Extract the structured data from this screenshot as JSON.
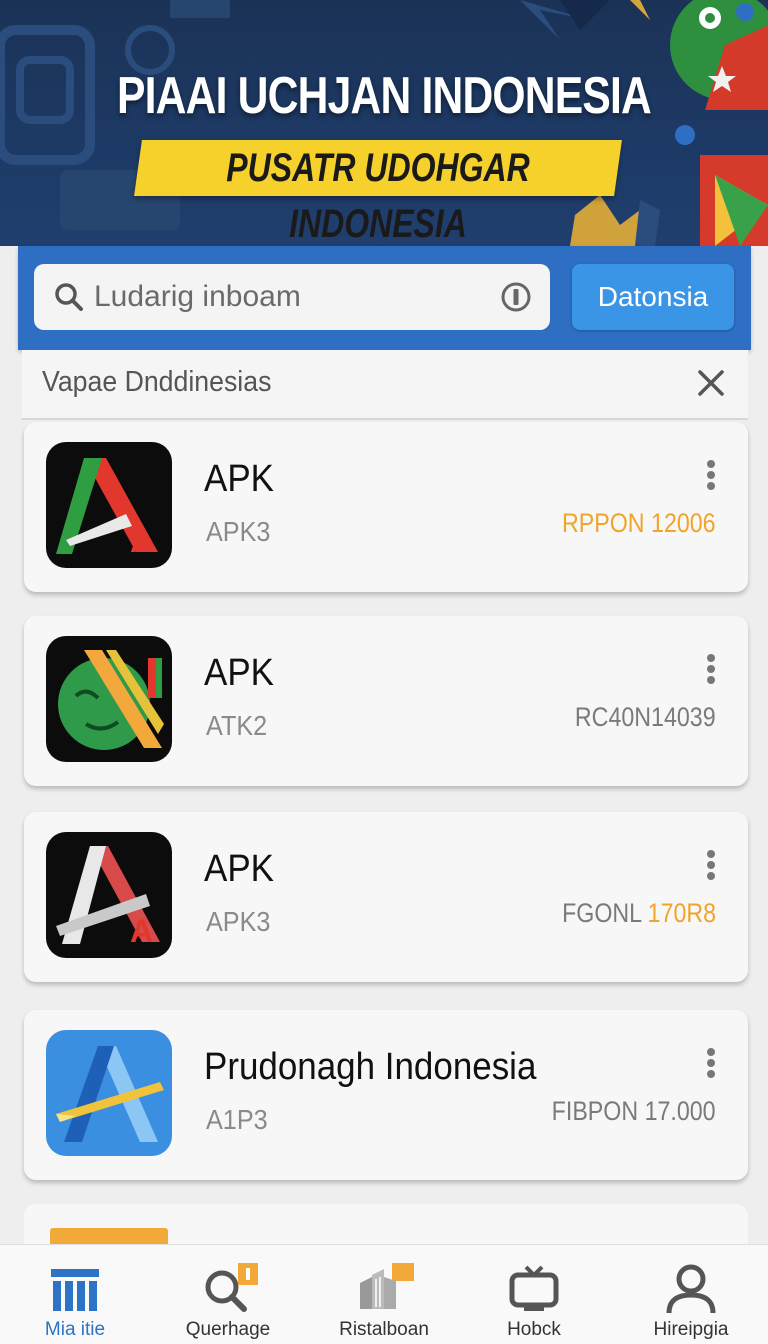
{
  "banner": {
    "title": "PIAAI UCHJAN INDONESIA",
    "subtitle": "PUSATR UDOHGAR INDONESIA"
  },
  "search": {
    "placeholder": "Ludarig inboam",
    "button_label": "Datonsia"
  },
  "filter": {
    "label": "Vapae Dnddinesias"
  },
  "apps": [
    {
      "name": "APK",
      "code": "APK3",
      "price": "RPPON 12006",
      "price_color": "#f0a42a",
      "icon": "red-green-a-icon"
    },
    {
      "name": "APK",
      "code": "ATK2",
      "price": "RC40N14039",
      "price_color": "#7a7a7a",
      "icon": "green-face-icon"
    },
    {
      "name": "APK",
      "code": "APK3",
      "price_prefix": "FGONL",
      "price": "170R8",
      "price_color": "#f0a42a",
      "icon": "white-red-a-icon"
    },
    {
      "name": "Prudonagh Indonesia",
      "code": "A1P3",
      "price": "FIBPON 17.000",
      "price_color": "#7a7a7a",
      "icon": "blue-a-icon"
    }
  ],
  "nav": {
    "items": [
      {
        "label": "Mia itie",
        "icon": "home-icon",
        "active": true
      },
      {
        "label": "Querhage",
        "icon": "search-icon",
        "active": false
      },
      {
        "label": "Ristalboan",
        "icon": "buildings-icon",
        "active": false
      },
      {
        "label": "Hobck",
        "icon": "tv-icon",
        "active": false
      },
      {
        "label": "Hireipgia",
        "icon": "profile-icon",
        "active": false
      }
    ]
  },
  "colors": {
    "banner_bg": "#1d3a66",
    "accent_blue": "#2e6fc4",
    "button_blue": "#3b95e6",
    "price_orange": "#f0a42a",
    "subtitle_yellow": "#f6d02b"
  }
}
